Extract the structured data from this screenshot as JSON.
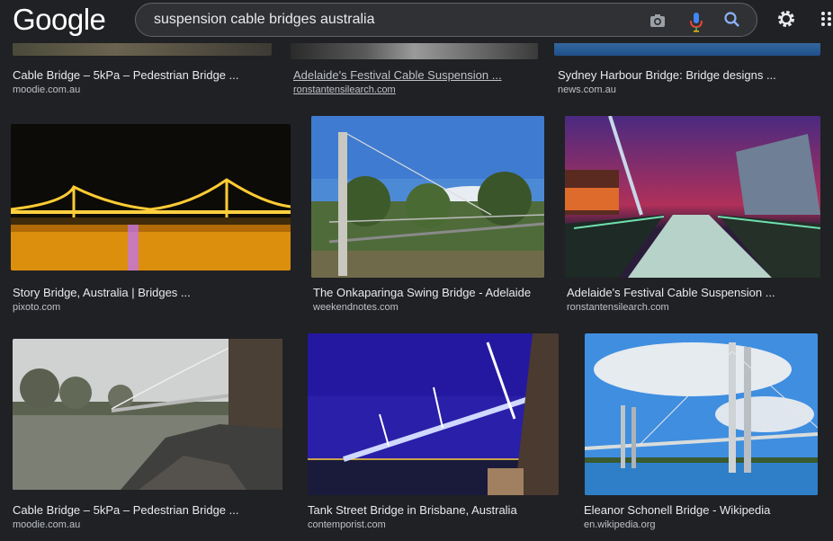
{
  "header": {
    "logo": "Google",
    "query": "suspension cable bridges australia",
    "icons": [
      "camera-icon",
      "mic-icon",
      "search-icon",
      "gear-icon",
      "apps-icon"
    ]
  },
  "results": [
    {
      "title": "Cable Bridge – 5kPa – Pedestrian Bridge ...",
      "source": "moodie.com.au"
    },
    {
      "title": "Adelaide's Festival Cable Suspension ...",
      "source": "ronstantensilearch.com"
    },
    {
      "title": "Sydney Harbour Bridge: Bridge designs ...",
      "source": "news.com.au"
    },
    {
      "title": "Story Bridge, Australia | Bridges ...",
      "source": "pixoto.com"
    },
    {
      "title": "The Onkaparinga Swing Bridge - Adelaide",
      "source": "weekendnotes.com"
    },
    {
      "title": "Adelaide's Festival Cable Suspension ...",
      "source": "ronstantensilearch.com"
    },
    {
      "title": "Cable Bridge – 5kPa – Pedestrian Bridge ...",
      "source": "moodie.com.au"
    },
    {
      "title": "Tank Street Bridge in Brisbane, Australia",
      "source": "contemporist.com"
    },
    {
      "title": "Eleanor Schonell Bridge - Wikipedia",
      "source": "en.wikipedia.org"
    }
  ],
  "colors": {
    "background": "#202124",
    "searchbox": "#303134",
    "text": "#e8eaed"
  }
}
